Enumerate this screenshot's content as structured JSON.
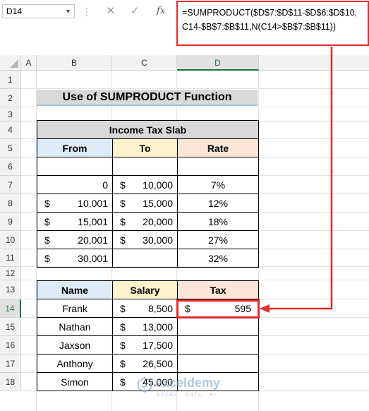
{
  "formula_bar": {
    "name_box": "D14",
    "fx_label": "fx",
    "formula_lines": [
      "=SUMPRODUCT($D$7:$D$11-$D$6:$D$10,",
      "C14-$B$7:$B$11,N(C14>$B$7:$B$11))"
    ]
  },
  "columns": [
    "A",
    "B",
    "C",
    "D"
  ],
  "rows": [
    "1",
    "2",
    "3",
    "4",
    "5",
    "6",
    "7",
    "8",
    "9",
    "10",
    "11",
    "12",
    "13",
    "14",
    "15",
    "16",
    "17",
    "18"
  ],
  "active_cell": {
    "column": "D",
    "row": "14"
  },
  "title": "Use of SUMPRODUCT Function",
  "tax_slab": {
    "caption": "Income Tax Slab",
    "headers": {
      "from": "From",
      "to": "To",
      "rate": "Rate"
    },
    "rows": [
      {
        "from_sym": "",
        "from": "",
        "to_sym": "",
        "to": "",
        "rate": ""
      },
      {
        "from_sym": "",
        "from": "0",
        "to_sym": "$",
        "to": "10,000",
        "rate": "7%"
      },
      {
        "from_sym": "$",
        "from": "10,001",
        "to_sym": "$",
        "to": "15,000",
        "rate": "12%"
      },
      {
        "from_sym": "$",
        "from": "15,001",
        "to_sym": "$",
        "to": "20,000",
        "rate": "18%"
      },
      {
        "from_sym": "$",
        "from": "20,001",
        "to_sym": "$",
        "to": "30,000",
        "rate": "27%"
      },
      {
        "from_sym": "$",
        "from": "30,001",
        "to_sym": "",
        "to": "",
        "rate": "32%"
      }
    ]
  },
  "salary_table": {
    "headers": {
      "name": "Name",
      "salary": "Salary",
      "tax": "Tax"
    },
    "rows": [
      {
        "name": "Frank",
        "salary_sym": "$",
        "salary": "8,500",
        "tax_sym": "$",
        "tax": "595"
      },
      {
        "name": "Nathan",
        "salary_sym": "$",
        "salary": "13,000",
        "tax_sym": "",
        "tax": ""
      },
      {
        "name": "Jaxson",
        "salary_sym": "$",
        "salary": "17,500",
        "tax_sym": "",
        "tax": ""
      },
      {
        "name": "Anthony",
        "salary_sym": "$",
        "salary": "26,500",
        "tax_sym": "",
        "tax": ""
      },
      {
        "name": "Simon",
        "salary_sym": "$",
        "salary": "45,000",
        "tax_sym": "",
        "tax": ""
      }
    ]
  },
  "watermark": {
    "name": "exceldemy",
    "tagline": "EXCEL · DATA · BI"
  },
  "colors": {
    "highlight": "#e32b2b",
    "header_blue": "#ddebf7",
    "header_yellow": "#fff2cc",
    "header_peach": "#fce4d6",
    "excel_green": "#217346"
  },
  "icons": [
    "dropdown-arrow-icon",
    "cancel-icon",
    "enter-icon",
    "function-icon",
    "select-all-icon"
  ]
}
